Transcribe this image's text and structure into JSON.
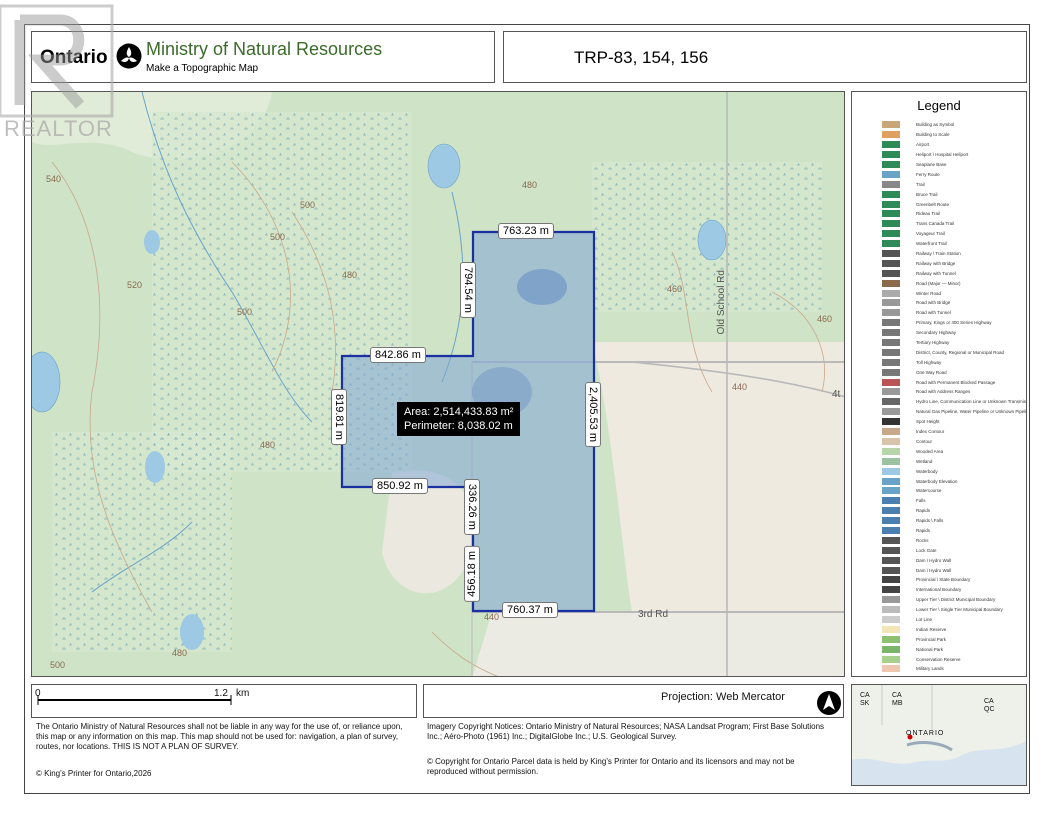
{
  "header": {
    "logo_word": "Ontario",
    "ministry": "Ministry of Natural Resources",
    "subtitle": "Make a Topographic Map",
    "map_title": "TRP-83, 154, 156"
  },
  "map": {
    "dimensions": {
      "top": "763.23 m",
      "left_upper": "794.54 m",
      "upper_left": "842.86 m",
      "west": "819.81 m",
      "east": "2,405.53 m",
      "lower_left": "850.92 m",
      "mid_vertical": "336.26 m",
      "low_vertical": "456.18 m",
      "bottom": "760.37 m"
    },
    "area": "Area: 2,514,433.83 m²",
    "perimeter": "Perimeter: 8,038.02 m",
    "roads": {
      "old_school": "Old School Rd",
      "third": "3rd Rd",
      "fourth": "4t"
    },
    "contours": [
      "540",
      "500",
      "500",
      "520",
      "480",
      "500",
      "460",
      "440",
      "460",
      "480",
      "440",
      "500",
      "480",
      "480"
    ]
  },
  "legend": {
    "title": "Legend",
    "items": [
      "Building as Symbol",
      "Building to Scale",
      "Airport",
      "Heliport \\ Hospital Heliport",
      "Seaplane Base",
      "Ferry Route",
      "Trail",
      "Bruce Trail",
      "Greenbelt Route",
      "Rideau Trail",
      "Trans Canada Trail",
      "Voyageur Trail",
      "Waterfront Trail",
      "Railway \\ Train Station",
      "Railway with Bridge",
      "Railway with Tunnel",
      "Road (Major — Minor)",
      "Winter Road",
      "Road with Bridge",
      "Road with Tunnel",
      "Primary, Kings or 400 Series Highway",
      "Secondary Highway",
      "Tertiary Highway",
      "District, County, Regional or Municipal Road",
      "Toll Highway",
      "One Way Road",
      "Road with Permanent Blocked Passage",
      "Road with Address Ranges",
      "Hydro Line, Communication Line or Unknown Transmission Line",
      "Natural Gas Pipeline, Water Pipeline or Unknown Pipeline",
      "Spot Height",
      "Index Contour",
      "Contour",
      "Wooded Area",
      "Wetland",
      "Waterbody",
      "Waterbody Elevation",
      "Watercourse",
      "Falls",
      "Rapids",
      "Rapids \\ Falls",
      "Rapids",
      "Rocks",
      "Lock Gate",
      "Dam \\ Hydro Wall",
      "Dam \\ Hydro Wall",
      "Provincial \\ State Boundary",
      "International Boundary",
      "Upper Tier \\ District Municipal Boundary",
      "Lower Tier \\ Single Tier Municipal Boundary",
      "Lot Line",
      "Indian Reserve",
      "Provincial Park",
      "National Park",
      "Conservation Reserve",
      "Military Lands"
    ]
  },
  "scale": {
    "start": "0",
    "end": "1.2",
    "unit": "km"
  },
  "projection": "Projection: Web Mercator",
  "disclaimer": "The Ontario Ministry of Natural Resources shall not be liable in any way for the use of, or reliance upon, this map or any information on this map. This map should not be used for: navigation, a plan of survey, routes, nor locations. THIS IS NOT A PLAN OF SURVEY.",
  "copyright_left": "© King's Printer for Ontario,2026",
  "imagery_notice": "Imagery Copyright Notices: Ontario Ministry of Natural Resources; NASA Landsat Program; First Base Solutions Inc.; Aéro-Photo (1961) Inc.; DigitalGlobe Inc.; U.S. Geological Survey.",
  "parcel_notice": "© Copyright for Ontario Parcel data is held by King's Printer for Ontario and its licensors and may not be reproduced without permission.",
  "inset": {
    "labels": [
      "CA",
      "SK",
      "CA",
      "MB",
      "CA",
      "QC",
      "ONTARIO"
    ]
  },
  "watermark": "REALTOR",
  "colors": {
    "parcel_fill": "#7fa6d6",
    "parcel_stroke": "#1a2fa0",
    "ministry_green": "#3b6b2a"
  }
}
